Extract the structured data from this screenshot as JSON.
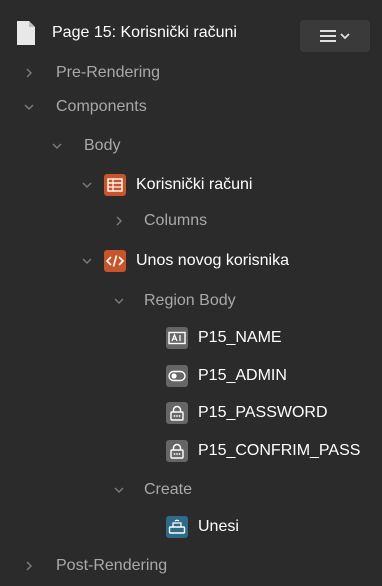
{
  "header": {
    "page_title": "Page 15: Korisnički računi",
    "menu_icon": "hamburger-menu-icon"
  },
  "tree": {
    "pre_rendering": "Pre-Rendering",
    "components": "Components",
    "body": "Body",
    "report_region": "Korisnički računi",
    "columns": "Columns",
    "form_region": "Unos novog korisnika",
    "region_body": "Region Body",
    "items": [
      "P15_NAME",
      "P15_ADMIN",
      "P15_PASSWORD",
      "P15_CONFRIM_PASS"
    ],
    "create": "Create",
    "button": "Unesi",
    "post_rendering": "Post-Rendering"
  },
  "colors": {
    "background": "#2b2b2b",
    "orange_icon": "#c7542a",
    "gray_icon": "#666666",
    "teal_icon": "#2f6a88"
  }
}
